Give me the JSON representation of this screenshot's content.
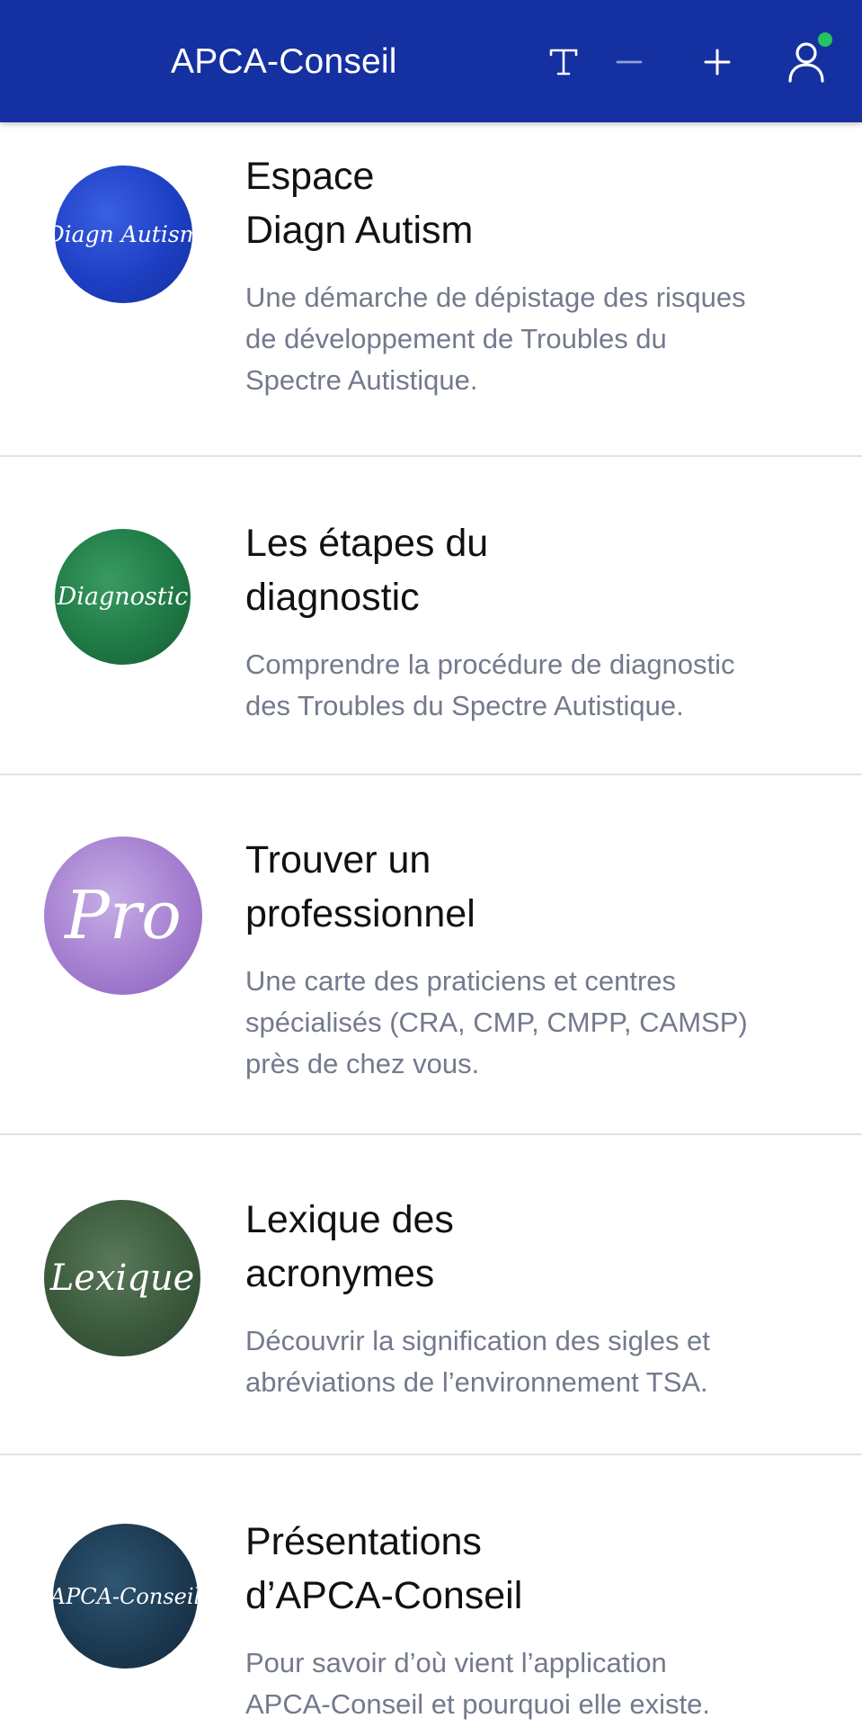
{
  "header": {
    "title": "APCA-Conseil",
    "background": "#1530a0",
    "status_color": "#22c55e",
    "icons": {
      "text_size": "text-size-icon",
      "decrease": "minus-icon",
      "increase": "plus-icon",
      "account": "user-icon"
    }
  },
  "items": [
    {
      "thumb_text": "Diagn Autism",
      "thumb_color": "#1d3fc4",
      "title_line1": "Espace",
      "title_line2": "Diagn Autism",
      "desc_line1": "Une démarche de dépistage des risques",
      "desc_line2": "de développement de Troubles du",
      "desc_line3": "Spectre Autistique."
    },
    {
      "thumb_text": "Diagnostic",
      "thumb_color": "#1f7a45",
      "title_line1": "Les étapes du",
      "title_line2": "diagnostic",
      "desc_line1": "Comprendre la procédure de diagnostic",
      "desc_line2": "des Troubles du Spectre Autistique."
    },
    {
      "thumb_text": "Pro",
      "thumb_color": "#a57fd0",
      "title_line1": "Trouver un",
      "title_line2": "professionnel",
      "desc_line1": "Une carte des praticiens et centres",
      "desc_line2": "spécialisés (CRA, CMP, CMPP, CAMSP)",
      "desc_line3": "près de chez vous."
    },
    {
      "thumb_text": "Lexique",
      "thumb_color": "#3c5a3c",
      "title_line1": "Lexique des",
      "title_line2": "acronymes",
      "desc_line1": "Découvrir la signification des sigles et",
      "desc_line2": "abréviations de l’environnement TSA."
    },
    {
      "thumb_text": "APCA-Conseil",
      "thumb_color": "#1c3a52",
      "title_line1": "Présentations",
      "title_line2": "d’APCA-Conseil",
      "desc_line1": "Pour savoir d’où vient l’application",
      "desc_line2": "APCA-Conseil et pourquoi elle existe."
    }
  ]
}
